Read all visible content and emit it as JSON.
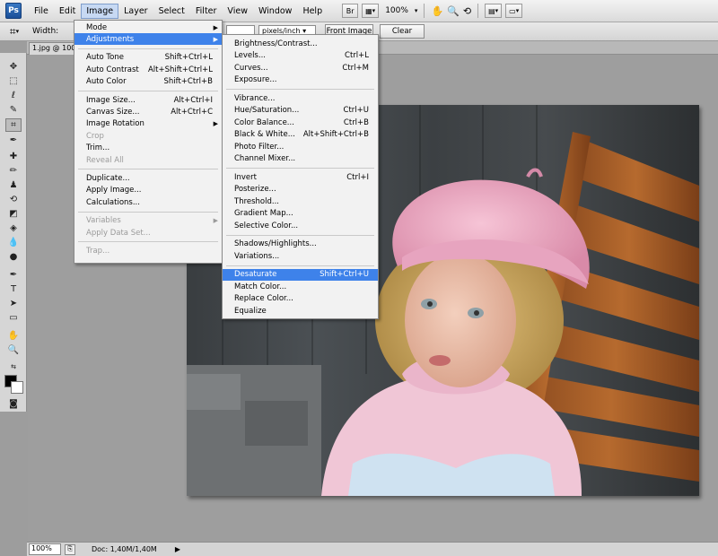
{
  "app": {
    "logo": "Ps"
  },
  "menubar": {
    "items": [
      "File",
      "Edit",
      "Image",
      "Layer",
      "Select",
      "Filter",
      "View",
      "Window",
      "Help"
    ],
    "active": "Image",
    "tools": {
      "br": "Br",
      "zoom": "100%"
    }
  },
  "options": {
    "width_label": "Width:",
    "resolution_unit": "pixels/inch",
    "front_image_btn": "Front Image",
    "clear_btn": "Clear"
  },
  "document": {
    "tab": "1.jpg @ 100%"
  },
  "status": {
    "zoom": "100%",
    "doc": "Doc: 1,40M/1,40M"
  },
  "image_menu": [
    {
      "label": "Mode",
      "arrow": true
    },
    {
      "label": "Adjustments",
      "arrow": true,
      "highlight": true
    },
    {
      "sep": true
    },
    {
      "label": "Auto Tone",
      "shortcut": "Shift+Ctrl+L"
    },
    {
      "label": "Auto Contrast",
      "shortcut": "Alt+Shift+Ctrl+L"
    },
    {
      "label": "Auto Color",
      "shortcut": "Shift+Ctrl+B"
    },
    {
      "sep": true
    },
    {
      "label": "Image Size...",
      "shortcut": "Alt+Ctrl+I"
    },
    {
      "label": "Canvas Size...",
      "shortcut": "Alt+Ctrl+C"
    },
    {
      "label": "Image Rotation",
      "arrow": true
    },
    {
      "label": "Crop",
      "disabled": true
    },
    {
      "label": "Trim..."
    },
    {
      "label": "Reveal All",
      "disabled": true
    },
    {
      "sep": true
    },
    {
      "label": "Duplicate..."
    },
    {
      "label": "Apply Image..."
    },
    {
      "label": "Calculations..."
    },
    {
      "sep": true
    },
    {
      "label": "Variables",
      "arrow": true,
      "disabled": true
    },
    {
      "label": "Apply Data Set...",
      "disabled": true
    },
    {
      "sep": true
    },
    {
      "label": "Trap...",
      "disabled": true
    }
  ],
  "adjustments_menu": [
    {
      "label": "Brightness/Contrast..."
    },
    {
      "label": "Levels...",
      "shortcut": "Ctrl+L"
    },
    {
      "label": "Curves...",
      "shortcut": "Ctrl+M"
    },
    {
      "label": "Exposure..."
    },
    {
      "sep": true
    },
    {
      "label": "Vibrance..."
    },
    {
      "label": "Hue/Saturation...",
      "shortcut": "Ctrl+U"
    },
    {
      "label": "Color Balance...",
      "shortcut": "Ctrl+B"
    },
    {
      "label": "Black & White...",
      "shortcut": "Alt+Shift+Ctrl+B"
    },
    {
      "label": "Photo Filter..."
    },
    {
      "label": "Channel Mixer..."
    },
    {
      "sep": true
    },
    {
      "label": "Invert",
      "shortcut": "Ctrl+I"
    },
    {
      "label": "Posterize..."
    },
    {
      "label": "Threshold..."
    },
    {
      "label": "Gradient Map..."
    },
    {
      "label": "Selective Color..."
    },
    {
      "sep": true
    },
    {
      "label": "Shadows/Highlights..."
    },
    {
      "label": "Variations..."
    },
    {
      "sep": true
    },
    {
      "label": "Desaturate",
      "shortcut": "Shift+Ctrl+U",
      "highlight": true
    },
    {
      "label": "Match Color..."
    },
    {
      "label": "Replace Color..."
    },
    {
      "label": "Equalize"
    }
  ]
}
